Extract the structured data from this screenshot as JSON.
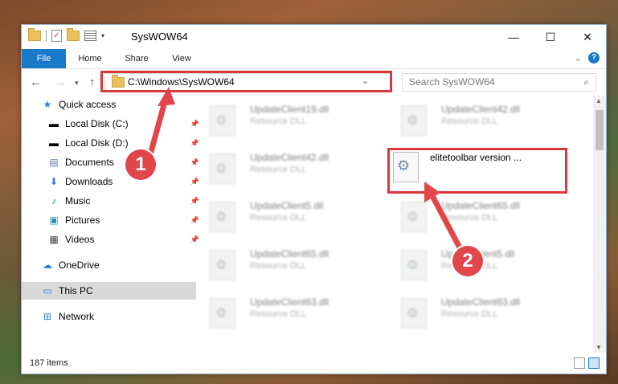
{
  "window": {
    "title": "SysWOW64",
    "caption_buttons": {
      "minimize": "—",
      "maximize": "☐",
      "close": "✕"
    }
  },
  "ribbon": {
    "tabs": [
      "File",
      "Home",
      "Share",
      "View"
    ],
    "collapse_chevron": "⌄",
    "help": "?"
  },
  "addressbar": {
    "path": "C:\\Windows\\SysWOW64",
    "search_placeholder": "Search SysWOW64"
  },
  "nav": {
    "quick_access": "Quick access",
    "items": [
      {
        "label": "Local Disk (C:)",
        "icon": "drive-icon",
        "pinned": true
      },
      {
        "label": "Local Disk (D:)",
        "icon": "drive-icon",
        "pinned": true
      },
      {
        "label": "Documents",
        "icon": "documents-icon",
        "pinned": true
      },
      {
        "label": "Downloads",
        "icon": "download-icon",
        "pinned": true
      },
      {
        "label": "Music",
        "icon": "music-icon",
        "pinned": true
      },
      {
        "label": "Pictures",
        "icon": "pictures-icon",
        "pinned": true
      },
      {
        "label": "Videos",
        "icon": "videos-icon",
        "pinned": true
      }
    ],
    "onedrive": "OneDrive",
    "this_pc": "This PC",
    "network": "Network"
  },
  "files": [
    {
      "name": "UpdateClient19.dll",
      "type": "Resource DLL"
    },
    {
      "name": "UpdateClient42.dll",
      "type": "Resource DLL"
    },
    {
      "name": "UpdateClient42.dll",
      "type": "Resource DLL"
    },
    {
      "name": "elitetoolbar version ...",
      "type": ""
    },
    {
      "name": "UpdateClient5.dll",
      "type": "Resource DLL"
    },
    {
      "name": "UpdateClient65.dll",
      "type": "Resource DLL"
    },
    {
      "name": "UpdateClient65.dll",
      "type": "Resource DLL"
    },
    {
      "name": "UpdateClient5.dll",
      "type": "Resource DLL"
    },
    {
      "name": "UpdateClient63.dll",
      "type": "Resource DLL"
    },
    {
      "name": "UpdateClient63.dll",
      "type": "Resource DLL"
    }
  ],
  "status": {
    "item_count": "187 items"
  },
  "annotations": {
    "step1": "1",
    "step2": "2",
    "color": "#e0464a"
  }
}
